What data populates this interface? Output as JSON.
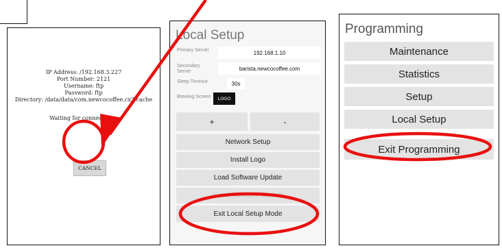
{
  "connection_panel": {
    "ip_address": "IP Address: /192.168.3.227",
    "port_number": "Port Number: 2121",
    "username": "Username: ftp",
    "password": "Password: ftp",
    "directory": "Directory: /data/data/com.newcocoffee.cx3/cache",
    "waiting_text": "Waiting for connection...",
    "cancel_label": "CANCEL"
  },
  "local_setup": {
    "title": "Local Setup",
    "fields": [
      {
        "label": "Primary Server",
        "value": "192.168.1.10"
      },
      {
        "label": "Secondary Server",
        "value": "barista.newcocoffee.com"
      },
      {
        "label": "Sleep Timeout",
        "value": "30s"
      },
      {
        "label": "Brewing Screen",
        "value": "LOGO"
      }
    ],
    "plus_label": "+",
    "minus_label": "-",
    "buttons": [
      {
        "label": "Network Setup",
        "enabled": true
      },
      {
        "label": "Install Logo",
        "enabled": true
      },
      {
        "label": "Load Software Update",
        "enabled": true
      },
      {
        "label": "Install Software Update",
        "enabled": false
      },
      {
        "label": "Exit Local Setup Mode",
        "enabled": true
      }
    ]
  },
  "programming": {
    "title": "Programming",
    "buttons": [
      {
        "label": "Maintenance"
      },
      {
        "label": "Statistics"
      },
      {
        "label": "Setup"
      },
      {
        "label": "Local Setup"
      },
      {
        "label": "Exit Programming"
      }
    ]
  },
  "annotation_color": "#e8100f"
}
